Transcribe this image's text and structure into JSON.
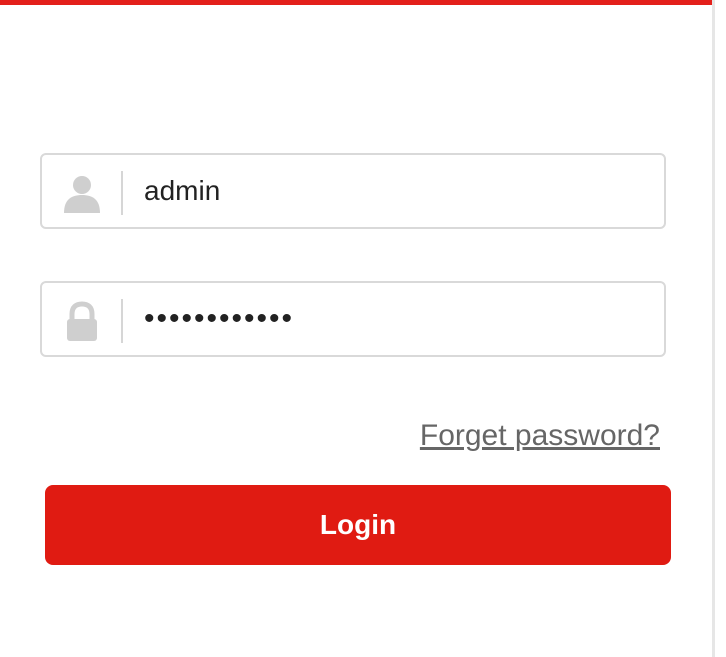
{
  "login_form": {
    "username": {
      "value": "admin",
      "icon": "user-icon"
    },
    "password": {
      "value": "123456789012",
      "icon": "lock-icon"
    },
    "forgot_link": "Forget password?",
    "login_button": "Login"
  },
  "colors": {
    "accent": "#e01b12",
    "top_bar": "#e3201b",
    "field_border": "#d9d9d9",
    "icon_gray": "#cfcfcf",
    "link_gray": "#666666"
  }
}
